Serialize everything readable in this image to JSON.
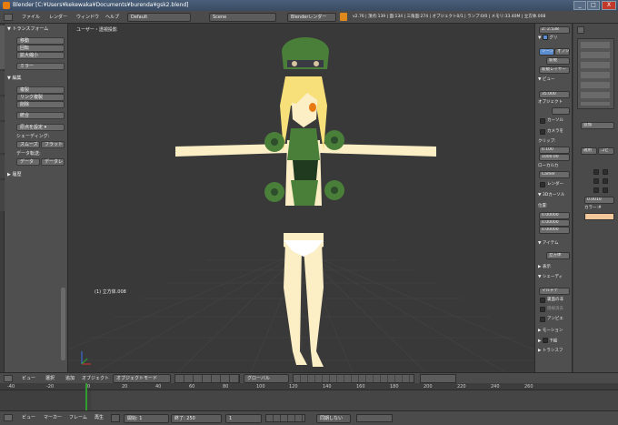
{
  "window": {
    "title": "Blender [C:¥Users¥kekewaka¥Documents¥burenda¥gsk2.blend]",
    "minimize": "_",
    "maximize": "□",
    "close": "X"
  },
  "menubar": {
    "items": [
      "ファイル",
      "レンダー",
      "ウィンドウ",
      "ヘルプ"
    ],
    "layout": "Default",
    "scene": "Scene",
    "render_engine": "Blenderレンダー",
    "stats": "v2.76 | 頂点:139 | 面:134 | 三角面:274 | オブジェクト0/1 | ランプ:0/0 | メモリ:33.40M | 立方体.008"
  },
  "toolshelf": {
    "tabs": [
      "ツール",
      "作成",
      "関係",
      "アニメーション",
      "物理演算",
      "グリースペンシル"
    ],
    "transform": {
      "header": "トランスフォーム",
      "buttons": [
        "移動",
        "回転",
        "拡大縮小",
        "ミラー"
      ]
    },
    "edit": {
      "header": "編集",
      "buttons": [
        "複製",
        "リンク複製",
        "削除",
        "統合"
      ],
      "origin": "原点を設定"
    },
    "shading": {
      "label": "シェーディング:",
      "smooth": "スムーズ",
      "flat": "フラット"
    },
    "data_transfer": {
      "label": "データ転送:",
      "data": "データ",
      "layout": "データレ"
    },
    "history": "履歴"
  },
  "viewport": {
    "view_label": "ユーザー・透視投影",
    "object_label": "(1) 立方体.008"
  },
  "npanel": {
    "value_top": "Z: 2.538",
    "grease_pencil": "グリ",
    "scene_btn": "シーン",
    "object_btn": "オブジ",
    "new_btn": "新規",
    "new_layer": "新規レイヤー",
    "view_header": "ビュー",
    "lens": "35.000",
    "lock_object": "オブジェクト",
    "lock_cursor": "カーソル",
    "lock_camera": "カメラを",
    "clip": "クリップ:",
    "clip_start": "0.100",
    "clip_end": "1000.00",
    "local_camera": "ローカルカ",
    "camera": "Camer",
    "render_border": "レンダー",
    "cursor_header": "3Dカーソル",
    "location": "位置:",
    "loc_x": "0.00000",
    "loc_y": "0.00000",
    "loc_z": "0.00000",
    "item_header": "アイテム",
    "item_name": "立方体",
    "display_header": "表示",
    "shading_header": "シェーディ",
    "matcap": "マルチテ",
    "backface": "裏面の非",
    "hidden_wire": "隠線消去",
    "ambient": "アンビエ",
    "motion_header": "モーション",
    "background_header": "下絵",
    "transform_orient_header": "トランスフ"
  },
  "props": {
    "world": "追加",
    "tab_new": "適用",
    "tab_copy": "コピ",
    "value": "0.0010",
    "color_label": "カラー:#"
  },
  "vp_header": {
    "view": "ビュー",
    "select": "選択",
    "add": "追加",
    "object": "オブジェクト",
    "mode": "オブジェクトモード",
    "orientation": "グローバル"
  },
  "timeline": {
    "ticks": [
      "-40",
      "-20",
      "0",
      "20",
      "40",
      "60",
      "80",
      "100",
      "120",
      "140",
      "160",
      "180",
      "200",
      "220",
      "240",
      "260"
    ],
    "current_frame": 1
  },
  "tl_header": {
    "view": "ビュー",
    "marker": "マーカー",
    "frame": "フレーム",
    "playback": "再生",
    "start": "開始: 1",
    "end": "終了: 250",
    "current": "1",
    "sync": "同期しない"
  }
}
